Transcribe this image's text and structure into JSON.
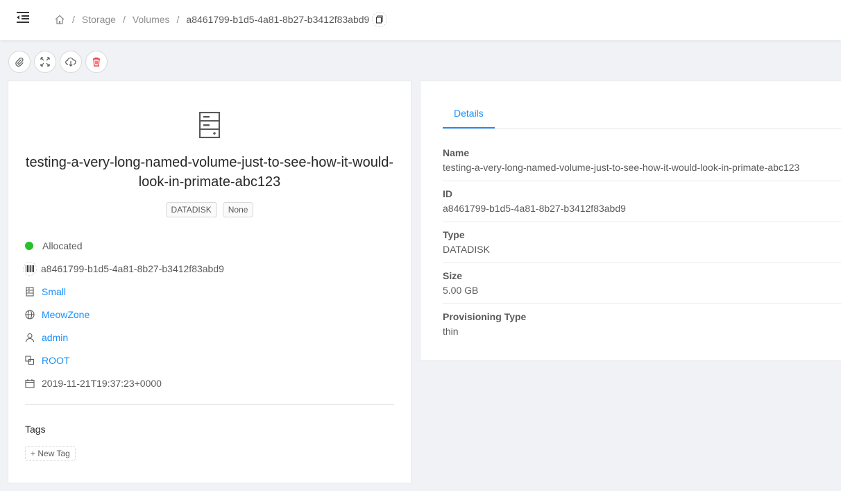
{
  "header": {
    "breadcrumb": {
      "storage": "Storage",
      "volumes": "Volumes",
      "current": "a8461799-b1d5-4a81-8b27-b3412f83abd9"
    }
  },
  "actions": [
    "paperclip-icon",
    "fullscreen-icon",
    "cloud-download-icon",
    "delete-icon"
  ],
  "volume": {
    "name": "testing-a-very-long-named-volume-just-to-see-how-it-would-look-in-primate-abc123",
    "tags": [
      "DATADISK",
      "None"
    ],
    "status": "Allocated",
    "id": "a8461799-b1d5-4a81-8b27-b3412f83abd9",
    "offering": "Small",
    "zone": "MeowZone",
    "account": "admin",
    "domain": "ROOT",
    "created": "2019-11-21T19:37:23+0000",
    "tags_title": "Tags",
    "new_tag": "New Tag"
  },
  "details": {
    "tab": "Details",
    "items": [
      {
        "label": "Name",
        "value": "testing-a-very-long-named-volume-just-to-see-how-it-would-look-in-primate-abc123"
      },
      {
        "label": "ID",
        "value": "a8461799-b1d5-4a81-8b27-b3412f83abd9"
      },
      {
        "label": "Type",
        "value": "DATADISK"
      },
      {
        "label": "Size",
        "value": "5.00 GB"
      },
      {
        "label": "Provisioning Type",
        "value": "thin"
      }
    ]
  },
  "colors": {
    "accent": "#1890ff",
    "status_allocated": "#2ac02a",
    "danger": "#f5222d"
  }
}
